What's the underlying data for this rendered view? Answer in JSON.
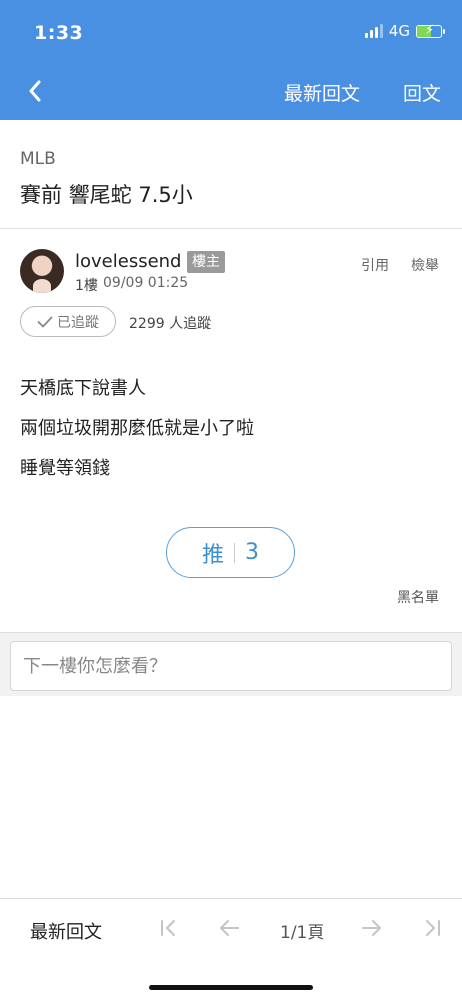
{
  "status_bar": {
    "time": "1:33",
    "network": "4G"
  },
  "nav": {
    "back_icon": "chevron-left-icon",
    "latest_label": "最新回文",
    "reply_label": "回文"
  },
  "thread": {
    "category": "MLB",
    "title": "賽前 響尾蛇 7.5小"
  },
  "post": {
    "author": "lovelessend",
    "op_badge": "樓主",
    "floor": "1樓",
    "date": "09/09 01:25",
    "quote_label": "引用",
    "report_label": "檢舉",
    "follow_label": "已追蹤",
    "follow_count": "2299 人追蹤",
    "body_lines": [
      "天橋底下說書人",
      "兩個垃圾開那麼低就是小了啦",
      "睡覺等領錢"
    ],
    "push_label": "推",
    "push_count": "3",
    "blacklist_label": "黑名單"
  },
  "reply_box": {
    "placeholder": "下一樓你怎麼看？"
  },
  "toolbar": {
    "latest_label": "最新回文",
    "page_indicator": "1/1頁"
  },
  "colors": {
    "brand_blue": "#4a90e2",
    "push_blue": "#3d8fd1",
    "badge_gray": "#9a9a9a",
    "battery_green": "#7ed957"
  }
}
